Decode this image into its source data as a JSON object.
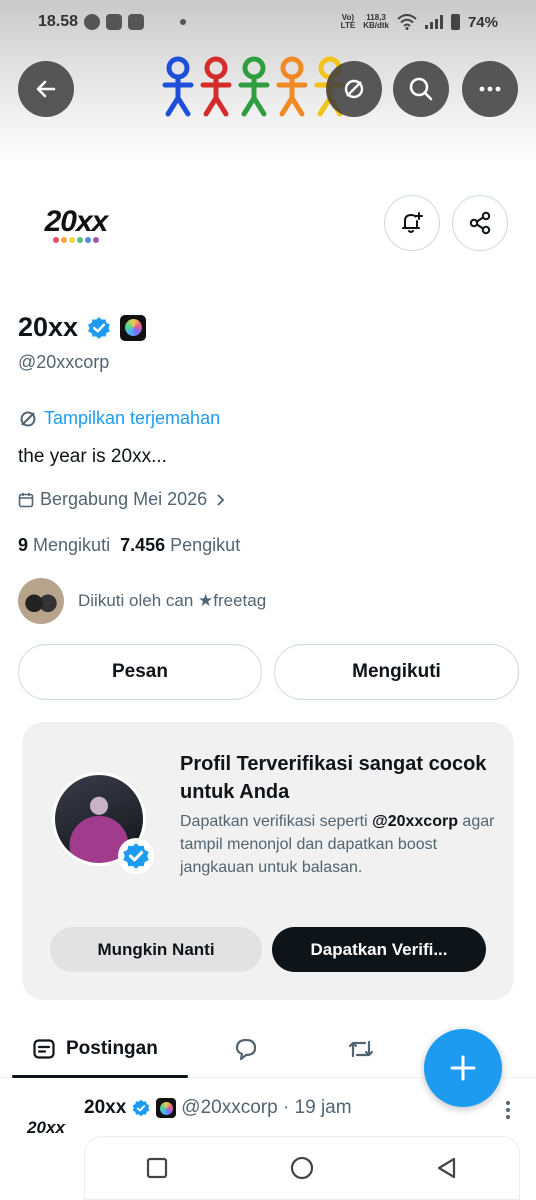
{
  "status_bar": {
    "time": "18.58",
    "net_top": "Vo)",
    "net_bottom": "LTE",
    "speed_top": "118,3",
    "speed_bottom": "KB/dtk",
    "battery": "74%"
  },
  "header": {
    "back_icon": "arrow-left-icon",
    "translate_icon": "translate-icon",
    "search_icon": "search-icon",
    "more_icon": "more-horizontal-icon",
    "banner_colors": [
      "#1d4fd8",
      "#d62b2b",
      "#2e9e3f",
      "#f08a24",
      "#f2c418",
      "#a23fb0"
    ]
  },
  "profile": {
    "avatar_text": "20xx",
    "avatar_dot_colors": [
      "#e84a5f",
      "#f7a642",
      "#f2d649",
      "#58c27d",
      "#4a90e2",
      "#9b59b6"
    ],
    "name": "20xx",
    "handle": "@20xxcorp",
    "translate_link": "Tampilkan terjemahan",
    "bio": "the year is 20xx...",
    "joined": "Bergabung Mei 2026",
    "following_count": "9",
    "following_label": "Mengikuti",
    "followers_count": "7.456",
    "followers_label": "Pengikut",
    "followed_by": "Diikuti oleh can ★freetag",
    "message_button": "Pesan",
    "following_button": "Mengikuti"
  },
  "verification_card": {
    "title": "Profil Terverifikasi sangat cocok untuk Anda",
    "desc_prefix": "Dapatkan verifikasi seperti",
    "desc_handle": "@20xxcorp",
    "desc_suffix": "agar tampil menonjol dan dapatkan boost jangkauan untuk balasan.",
    "later_button": "Mungkin Nanti",
    "verify_button": "Dapatkan Verifi..."
  },
  "tabs": {
    "posts": "Postingan"
  },
  "post": {
    "avatar_text": "20xx",
    "name": "20xx",
    "meta": "@20xxcorp · 19 jam"
  },
  "colors": {
    "accent": "#1d9bf0",
    "text": "#0f1419",
    "muted": "#536471"
  }
}
